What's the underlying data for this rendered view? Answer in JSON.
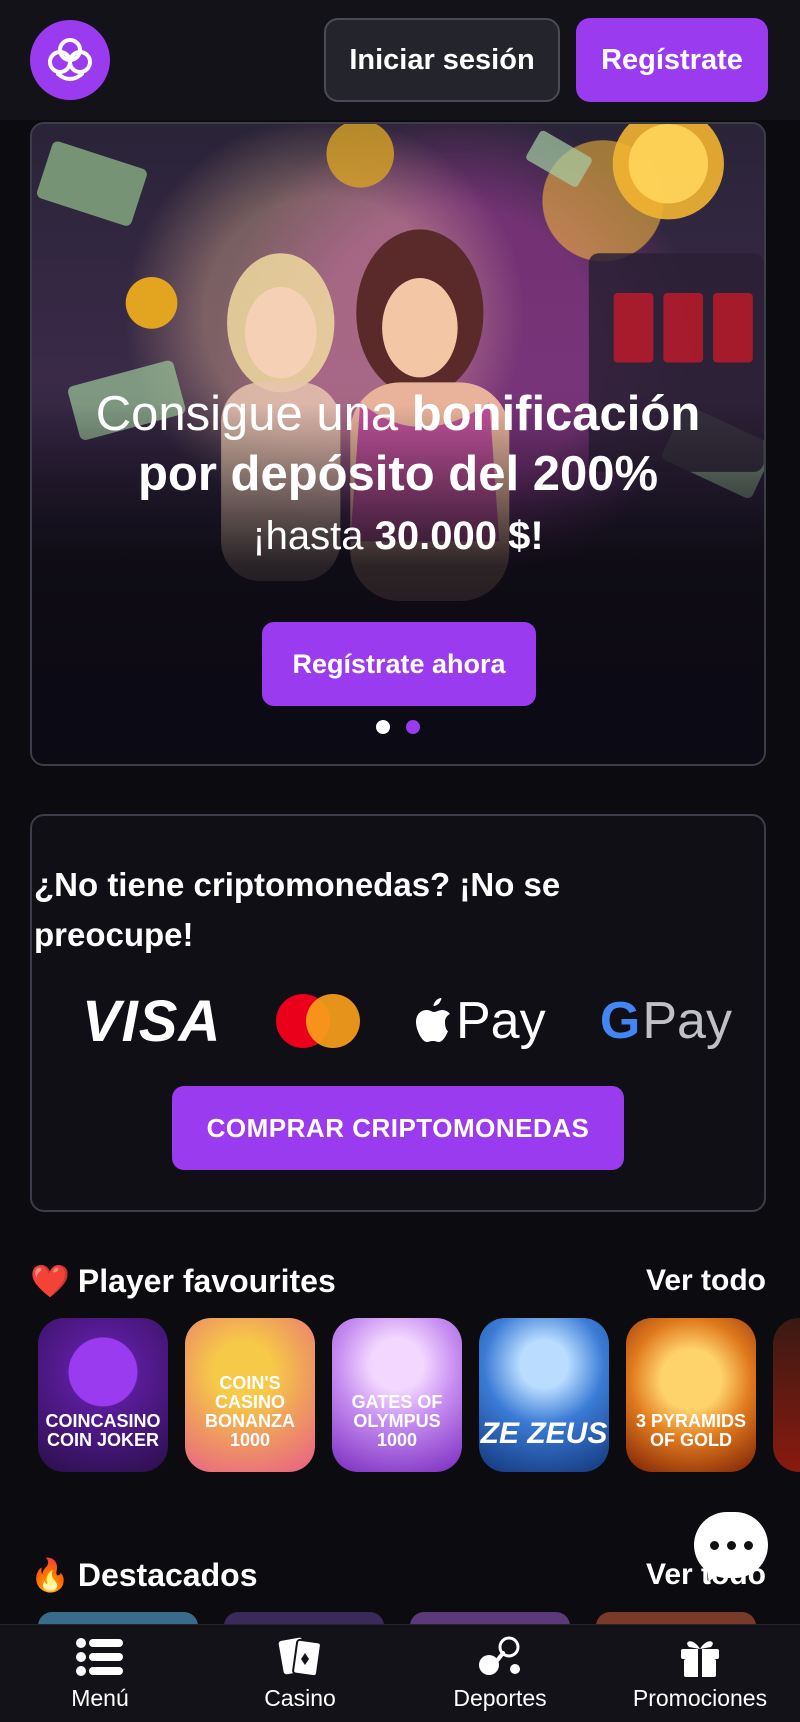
{
  "header": {
    "login_label": "Iniciar sesión",
    "register_label": "Regístrate"
  },
  "banner": {
    "headline_part1": "Consigue una",
    "headline_part2": "bonificación",
    "headline_line2": "por depósito del 200%",
    "subline_prefix": "¡hasta",
    "subline_amount": "30.000 $!",
    "cta_label": "Regístrate ahora",
    "slides": 2,
    "active_slide": 2
  },
  "crypto": {
    "title": "¿No tiene criptomonedas? ¡No se preocupe!",
    "payments": {
      "visa": "VISA",
      "mastercard": "mastercard-logo",
      "apple": "Pay",
      "google": "Pay"
    },
    "cta_label": "COMPRAR CRIPTOMONEDAS"
  },
  "favourites": {
    "emoji": "❤️",
    "title": "Player favourites",
    "see_all": "Ver todo",
    "games": [
      {
        "name": "CoinCasino Coin Joker"
      },
      {
        "name": "Coin's Casino Bonanza 1000"
      },
      {
        "name": "Gates of Olympus 1000"
      },
      {
        "name": "Ze Zeus"
      },
      {
        "name": "3 Pyramids of Gold"
      },
      {
        "name": ""
      }
    ]
  },
  "featured": {
    "emoji": "🔥",
    "title": "Destacados",
    "see_all": "Ver todo"
  },
  "bottom_nav": {
    "items": [
      {
        "label": "Menú",
        "icon": "menu-icon"
      },
      {
        "label": "Casino",
        "icon": "cards-icon"
      },
      {
        "label": "Deportes",
        "icon": "sports-icon"
      },
      {
        "label": "Promociones",
        "icon": "gift-icon"
      }
    ]
  },
  "colors": {
    "accent": "#9b3bf0",
    "background": "#0b0b10",
    "header": "#121218"
  }
}
